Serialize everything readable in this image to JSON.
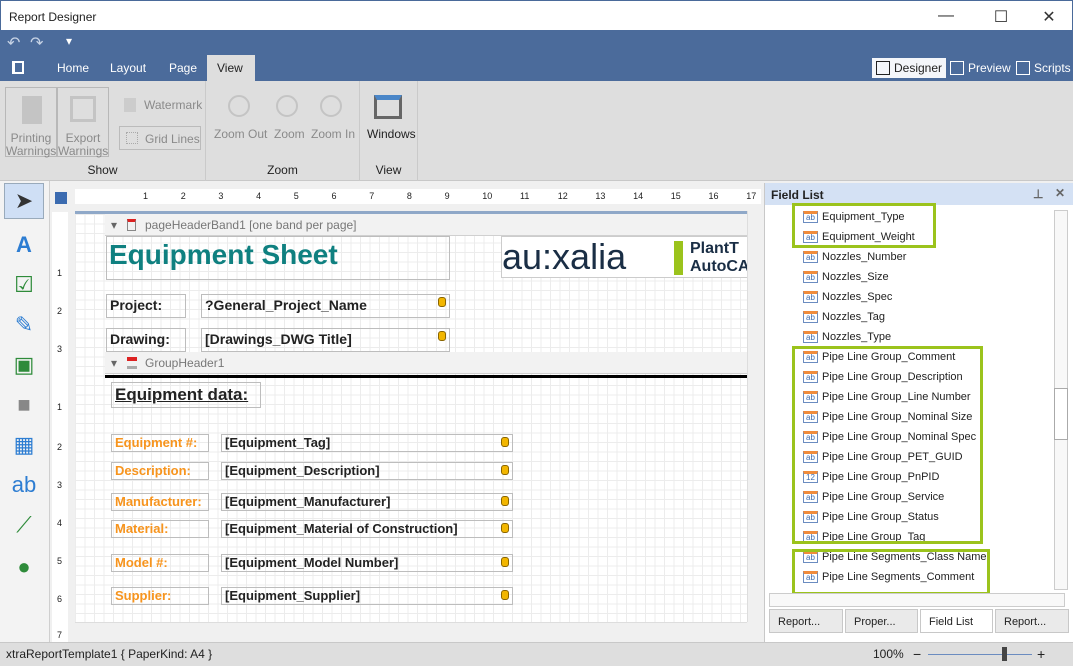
{
  "window": {
    "title": "Report Designer",
    "minimize": "—",
    "maximize": "☐",
    "close": "✕"
  },
  "qat": {
    "undo": "↶",
    "redo": "↷",
    "dropdown": "▾"
  },
  "tabs": [
    {
      "label": "Home"
    },
    {
      "label": "Layout"
    },
    {
      "label": "Page"
    },
    {
      "label": "View",
      "active": true
    }
  ],
  "right_tabs": [
    {
      "label": "Designer",
      "active": true
    },
    {
      "label": "Preview"
    },
    {
      "label": "Scripts"
    }
  ],
  "ribbon": {
    "show": {
      "label": "Show",
      "printing_warnings": "Printing Warnings",
      "export_warnings": "Export Warnings",
      "watermark": "Watermark",
      "grid_lines": "Grid Lines"
    },
    "zoom": {
      "label": "Zoom",
      "zoom_out": "Zoom Out",
      "zoom": "Zoom",
      "zoom_in": "Zoom In"
    },
    "view": {
      "label": "View",
      "windows": "Windows"
    }
  },
  "ruler": {
    "top": [
      "1",
      "2",
      "3",
      "4",
      "5",
      "6",
      "7",
      "8",
      "9",
      "10",
      "11",
      "12",
      "13",
      "14",
      "15",
      "16",
      "17"
    ],
    "left": [
      "1",
      "2",
      "3",
      "1",
      "2",
      "3",
      "4",
      "5",
      "6",
      "7"
    ]
  },
  "report": {
    "page_header_band": "pageHeaderBand1 [one band per page]",
    "title": "Equipment Sheet",
    "logo_text": "au:xalia",
    "logo_sub1": "PlantT",
    "logo_sub2": "AutoCA",
    "project_label": "Project:",
    "project_value": "?General_Project_Name",
    "drawing_label": "Drawing:",
    "drawing_value": "[Drawings_DWG Title]",
    "group_header_band": "GroupHeader1",
    "section_title": "Equipment data:",
    "rows": [
      {
        "label": "Equipment #:",
        "value": "[Equipment_Tag]"
      },
      {
        "label": "Description:",
        "value": "[Equipment_Description]"
      },
      {
        "label": "Manufacturer:",
        "value": "[Equipment_Manufacturer]"
      },
      {
        "label": "Material:",
        "value": "[Equipment_Material of Construction]"
      },
      {
        "label": "Model #:",
        "value": "[Equipment_Model Number]"
      },
      {
        "label": "Supplier:",
        "value": "[Equipment_Supplier]"
      }
    ]
  },
  "field_list": {
    "title": "Field List",
    "items": [
      {
        "label": "Equipment_Type",
        "type": "ab"
      },
      {
        "label": "Equipment_Weight",
        "type": "ab"
      },
      {
        "label": "Nozzles_Number",
        "type": "ab"
      },
      {
        "label": "Nozzles_Size",
        "type": "ab"
      },
      {
        "label": "Nozzles_Spec",
        "type": "ab"
      },
      {
        "label": "Nozzles_Tag",
        "type": "ab"
      },
      {
        "label": "Nozzles_Type",
        "type": "ab"
      },
      {
        "label": "Pipe Line Group_Comment",
        "type": "ab"
      },
      {
        "label": "Pipe Line Group_Description",
        "type": "ab"
      },
      {
        "label": "Pipe Line Group_Line Number",
        "type": "ab"
      },
      {
        "label": "Pipe Line Group_Nominal Size",
        "type": "ab"
      },
      {
        "label": "Pipe Line Group_Nominal Spec",
        "type": "ab"
      },
      {
        "label": "Pipe Line Group_PET_GUID",
        "type": "ab"
      },
      {
        "label": "Pipe Line Group_PnPID",
        "type": "12"
      },
      {
        "label": "Pipe Line Group_Service",
        "type": "ab"
      },
      {
        "label": "Pipe Line Group_Status",
        "type": "ab"
      },
      {
        "label": "Pipe Line Group_Tag",
        "type": "ab"
      },
      {
        "label": "Pipe Line Segments_Class Name",
        "type": "ab"
      },
      {
        "label": "Pipe Line Segments_Comment",
        "type": "ab"
      }
    ],
    "highlight_color": "#9bc31c"
  },
  "panel_tabs": [
    {
      "label": "Report..."
    },
    {
      "label": "Proper..."
    },
    {
      "label": "Field List",
      "active": true
    },
    {
      "label": "Report..."
    }
  ],
  "status": {
    "text": "xtraReportTemplate1 { PaperKind: A4 }",
    "zoom": "100%",
    "zoom_level": 100,
    "minus": "−",
    "plus": "+"
  }
}
